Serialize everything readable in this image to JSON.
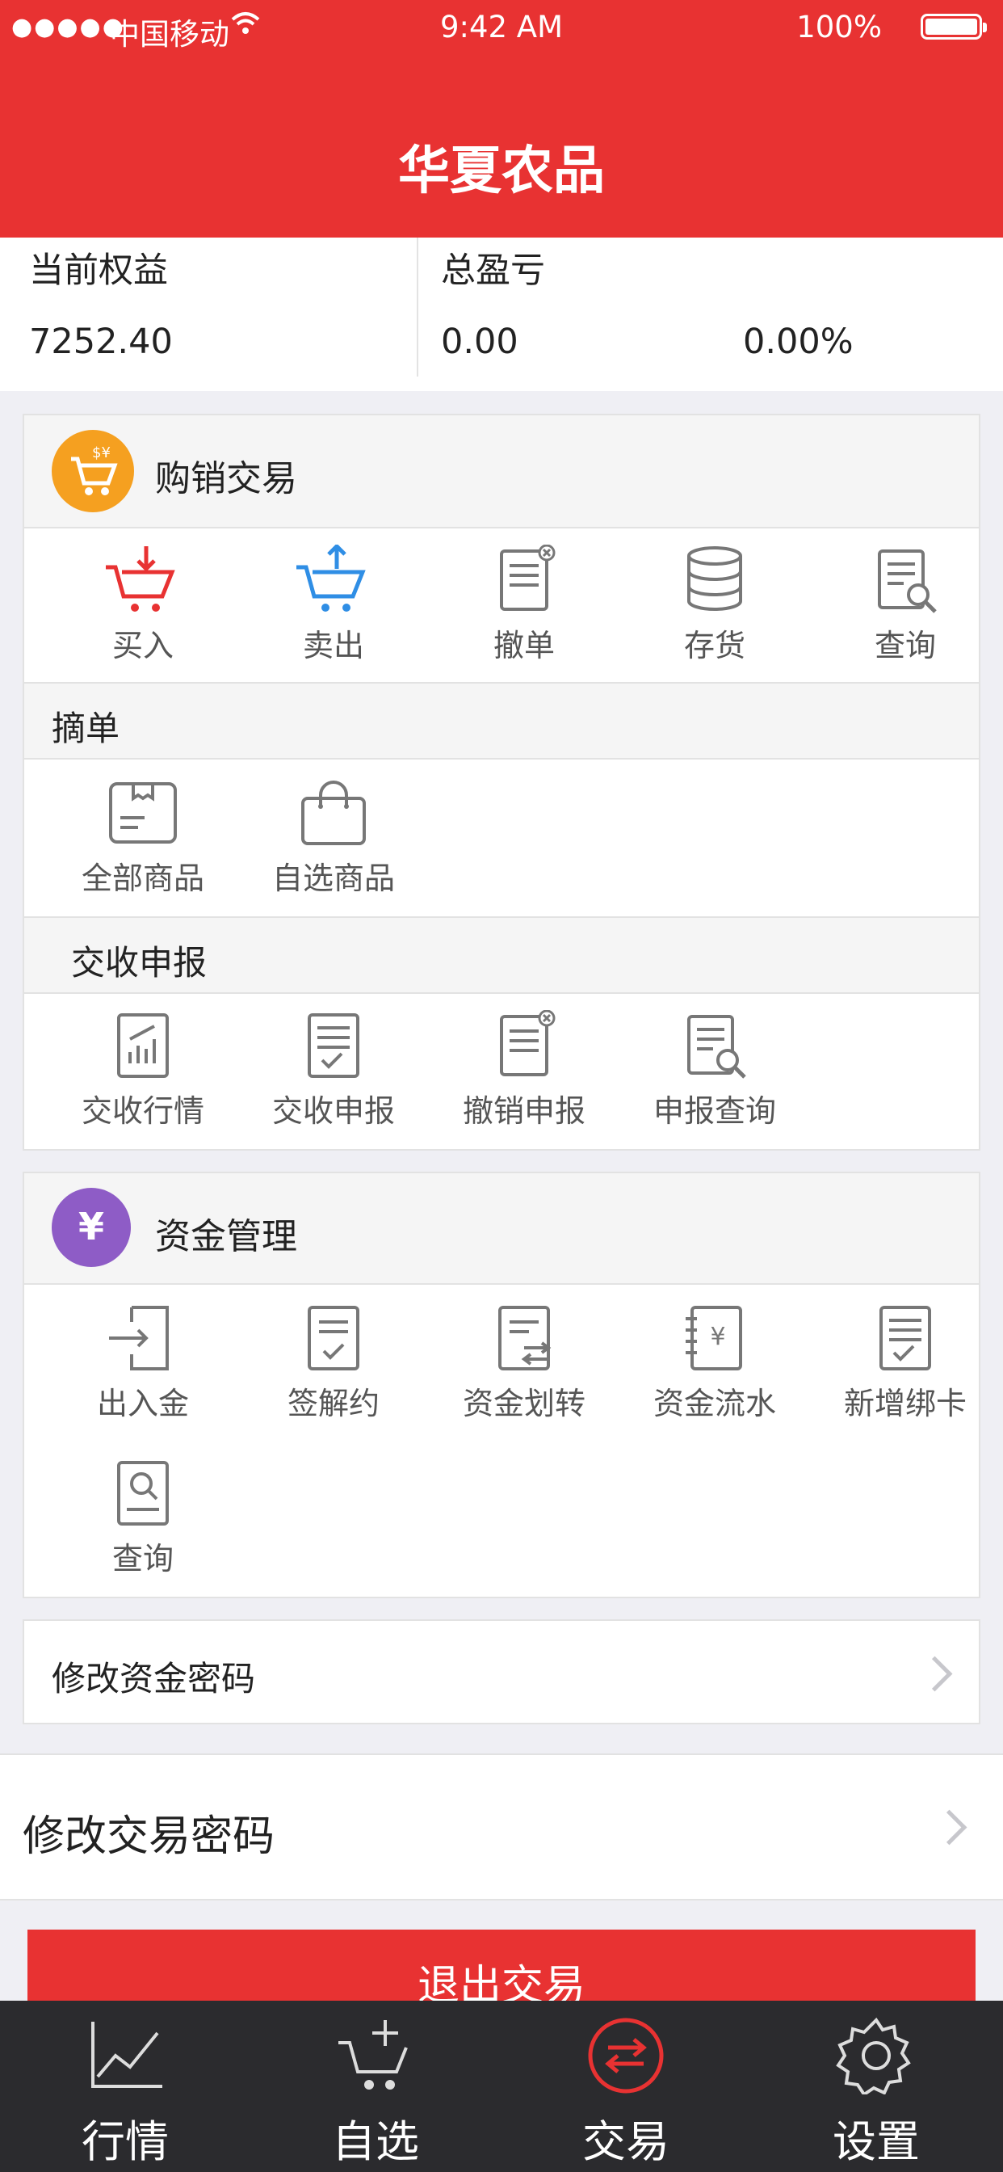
{
  "status": {
    "carrier": "中国移动",
    "time": "9:42 AM",
    "battery": "100%"
  },
  "nav": {
    "title": "华夏农品"
  },
  "summary": {
    "equity_label": "当前权益",
    "equity_value": "7252.40",
    "pl_label": "总盈亏",
    "pl_value": "0.00",
    "pl_percent": "0.00%"
  },
  "trade_card": {
    "title": "购销交易",
    "actions": [
      "买入",
      "卖出",
      "撤单",
      "存货",
      "查询"
    ],
    "pick_section": "摘单",
    "pick_items": [
      "全部商品",
      "自选商品"
    ],
    "delivery_section": "交收申报",
    "delivery_items": [
      "交收行情",
      "交收申报",
      "撤销申报",
      "申报查询"
    ]
  },
  "fund_card": {
    "title": "资金管理",
    "items": [
      "出入金",
      "签解约",
      "资金划转",
      "资金流水",
      "新增绑卡",
      "查询"
    ],
    "change_fund_password": "修改资金密码"
  },
  "change_trade_password": "修改交易密码",
  "logout": "退出交易",
  "tabs": [
    "行情",
    "自选",
    "交易",
    "设置"
  ],
  "colors": {
    "brand_red": "#e83232",
    "tab_bg": "#2b2b2e",
    "icon_orange": "#f5a020",
    "icon_purple": "#8e5cc6",
    "buy_red": "#e83232",
    "sell_blue": "#2f8ee5"
  }
}
